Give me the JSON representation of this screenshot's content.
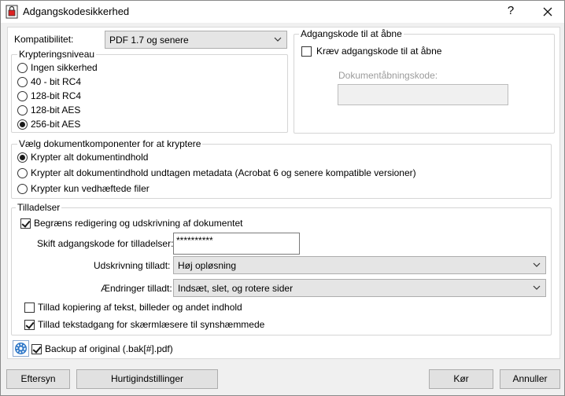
{
  "window": {
    "title": "Adgangskodesikkerhed",
    "help_glyph": "?"
  },
  "compatibility": {
    "label": "Kompatibilitet:",
    "value": "PDF 1.7 og senere"
  },
  "encryption_level": {
    "legend": "Krypteringsniveau",
    "options": [
      "Ingen sikkerhed",
      "40 - bit RC4",
      "128-bit RC4",
      "128-bit AES",
      "256-bit AES"
    ],
    "selected_index": 4
  },
  "open_password": {
    "legend": "Adgangskode til at åbne",
    "require_label": "Kræv adgangskode til at åbne",
    "require_checked": false,
    "doc_password_label": "Dokumentåbningskode:",
    "doc_password_value": ""
  },
  "components": {
    "legend": "Vælg dokumentkomponenter for at kryptere",
    "options": [
      "Krypter alt dokumentindhold",
      "Krypter alt dokumentindhold undtagen metadata (Acrobat 6 og senere kompatible versioner)",
      "Krypter kun vedhæftede filer"
    ],
    "selected_index": 0
  },
  "permissions": {
    "legend": "Tilladelser",
    "restrict_label": "Begræns redigering og udskrivning af dokumentet",
    "restrict_checked": true,
    "change_password_label": "Skift adgangskode for tilladelser:",
    "change_password_value": "**********",
    "printing_label": "Udskrivning tilladt:",
    "printing_value": "Høj opløsning",
    "changes_label": "Ændringer tilladt:",
    "changes_value": "Indsæt, slet, og rotere sider",
    "copy_label": "Tillad kopiering af tekst, billeder og andet indhold",
    "copy_checked": false,
    "screenreader_label": "Tillad tekstadgang for skærmlæsere til synshæmmede",
    "screenreader_checked": true
  },
  "backup": {
    "label": "Backup af original (.bak[#].pdf)",
    "checked": true,
    "icon": "settings-gear-icon"
  },
  "buttons": {
    "preview": "Eftersyn",
    "quick_settings": "Hurtigindstillinger",
    "run": "Kør",
    "cancel": "Annuller"
  }
}
